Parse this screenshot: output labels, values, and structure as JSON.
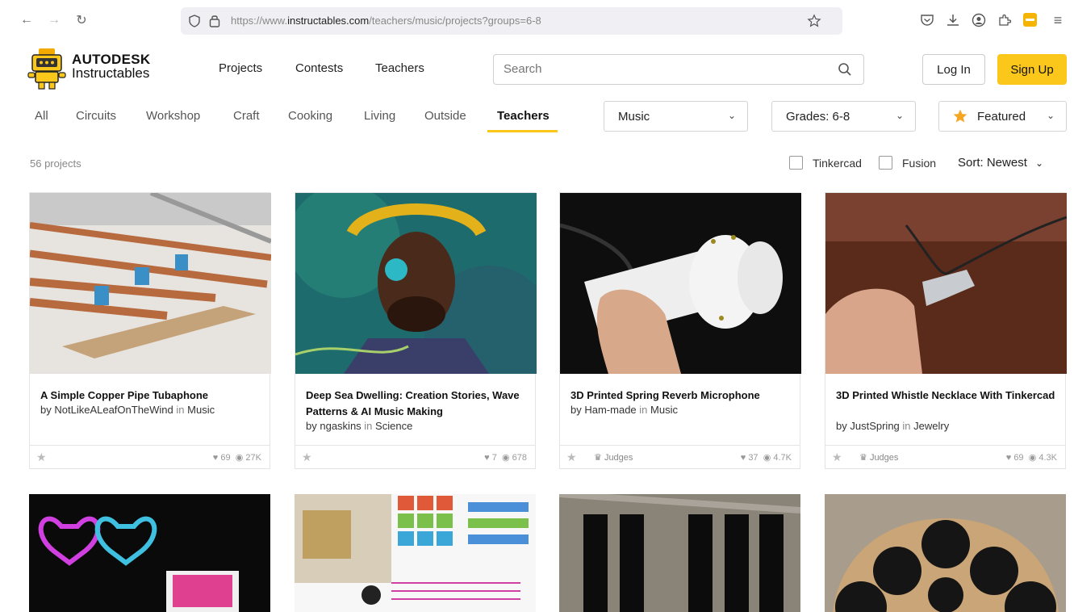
{
  "browser": {
    "url_prefix": "https://www.",
    "url_domain": "instructables.com",
    "url_path": "/teachers/music/projects?groups=6-8"
  },
  "site": {
    "brand_top": "AUTODESK",
    "brand_bottom": "Instructables",
    "nav": [
      "Projects",
      "Contests",
      "Teachers"
    ],
    "search_placeholder": "Search",
    "login": "Log In",
    "signup": "Sign Up"
  },
  "categories": [
    "All",
    "Circuits",
    "Workshop",
    "Craft",
    "Cooking",
    "Living",
    "Outside",
    "Teachers"
  ],
  "active_category": "Teachers",
  "filters": {
    "channel": "Music",
    "grades": "Grades: 6-8",
    "featured": "Featured"
  },
  "results": {
    "count": "56 projects",
    "tinkercad": "Tinkercad",
    "fusion": "Fusion",
    "sort": "Sort: Newest"
  },
  "cards": [
    {
      "title": "A Simple Copper Pipe Tubaphone",
      "author": "NotLikeALeafOnTheWind",
      "in": "in",
      "category": "Music",
      "by": "by",
      "judges": "",
      "likes": "69",
      "views": "27K"
    },
    {
      "title": "Deep Sea Dwelling: Creation Stories, Wave Patterns & AI Music Making",
      "author": "ngaskins",
      "in": "in",
      "category": "Science",
      "by": "by",
      "judges": "",
      "likes": "7",
      "views": "678"
    },
    {
      "title": "3D Printed Spring Reverb Microphone",
      "author": "Ham-made",
      "in": "in",
      "category": "Music",
      "by": "by",
      "judges": "Judges",
      "likes": "37",
      "views": "4.7K"
    },
    {
      "title": "3D Printed Whistle Necklace With Tinkercad",
      "author": "JustSpring",
      "in": "in",
      "category": "Jewelry",
      "by": "by",
      "judges": "Judges",
      "likes": "69",
      "views": "4.3K"
    }
  ],
  "colors": {
    "accent": "#fac71a"
  }
}
